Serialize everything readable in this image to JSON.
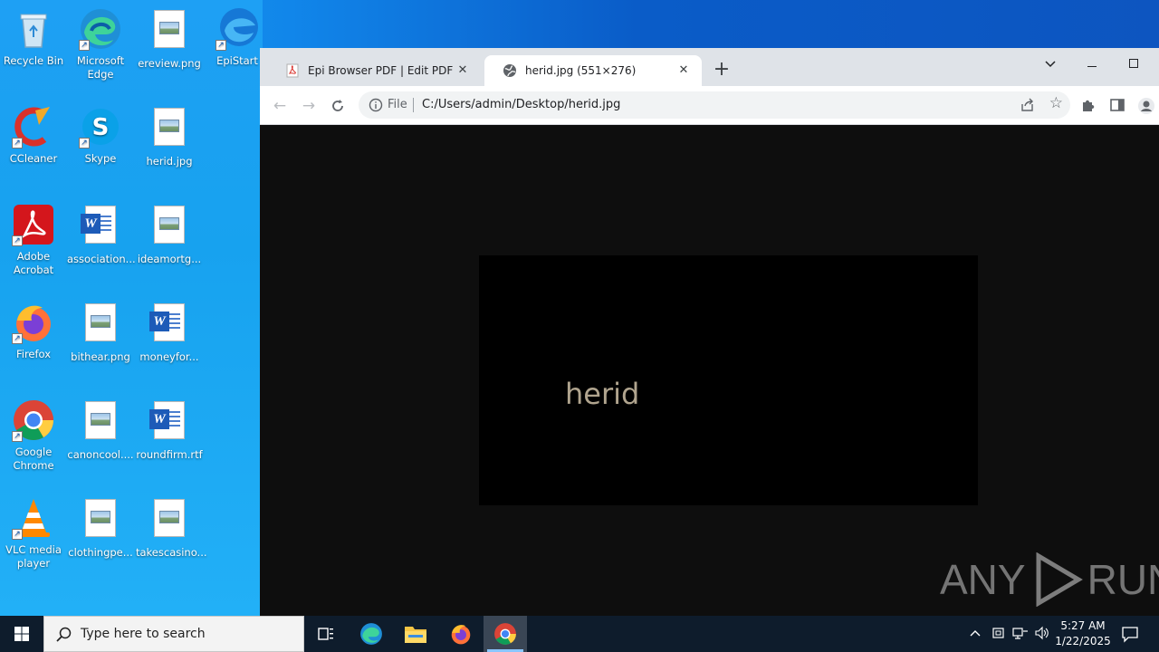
{
  "desktop": {
    "icons": [
      {
        "label": "Recycle Bin"
      },
      {
        "label": "Microsoft Edge"
      },
      {
        "label": "ereview.png"
      },
      {
        "label": "EpiStart"
      },
      {
        "label": "CCleaner"
      },
      {
        "label": "Skype"
      },
      {
        "label": "herid.jpg"
      },
      {
        "label": "Adobe Acrobat"
      },
      {
        "label": "association..."
      },
      {
        "label": "ideamortg..."
      },
      {
        "label": "Firefox"
      },
      {
        "label": "bithear.png"
      },
      {
        "label": "moneyfor..."
      },
      {
        "label": "Google Chrome"
      },
      {
        "label": "canoncool...."
      },
      {
        "label": "roundfirm.rtf"
      },
      {
        "label": "VLC media player"
      },
      {
        "label": "clothingpe..."
      },
      {
        "label": "takescasino..."
      }
    ]
  },
  "browser": {
    "tabs": [
      {
        "title": "Epi Browser PDF | Edit PDF",
        "active": false
      },
      {
        "title": "herid.jpg (551×276)",
        "active": true
      }
    ],
    "omnibox": {
      "scheme_label": "File",
      "url": "C:/Users/admin/Desktop/herid.jpg"
    },
    "image": {
      "text": "herid"
    }
  },
  "watermark": {
    "text_left": "ANY",
    "text_right": "RUN"
  },
  "taskbar": {
    "search_placeholder": "Type here to search",
    "time": "5:27 AM",
    "date": "1/22/2025"
  },
  "colors": {
    "desktop_accent": "#1ea0f4",
    "tab_bar": "#dfe3e8",
    "viewer_bg": "#0e0e0e",
    "image_text": "#b0a48e",
    "taskbar": "#0e1c2c"
  }
}
